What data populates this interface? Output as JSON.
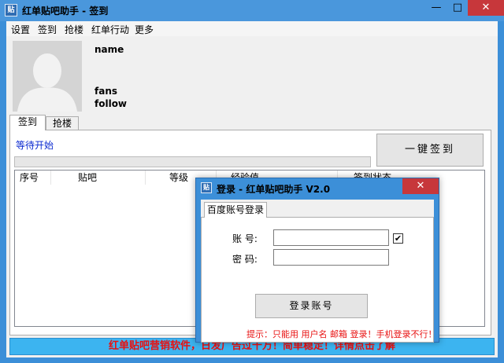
{
  "window": {
    "title": "红单贴吧助手 - 签到",
    "icon_glyph": "贴",
    "minimize_icon": "minimize-icon",
    "maximize_icon": "maximize-icon",
    "close_icon": "close-icon",
    "title_color": "#4a97dc"
  },
  "menu": [
    "设置",
    "签到",
    "抢楼",
    "红单行动",
    "更多"
  ],
  "profile": {
    "name_label": "name",
    "fans_label": "fans",
    "follow_label": "follow"
  },
  "tabs": [
    "签到",
    "抢楼"
  ],
  "sign_panel": {
    "status": "等待开始",
    "progress": 0,
    "sign_button": "一键签到",
    "columns": [
      "序号",
      "贴吧",
      "等级",
      "经验值",
      "签到状态"
    ]
  },
  "footer_text": "红单贴吧营销软件，日发广告过千万！简单稳定！详情点击了解",
  "dialog": {
    "title": "登录 - 红单贴吧助手 V2.0",
    "tab": "百度账号登录",
    "account_label": "账 号:",
    "password_label": "密 码:",
    "account_value": "",
    "password_value": "",
    "remember_checked": true,
    "login_button": "登录账号",
    "hint": "提示：只能用 用户名 邮箱 登录！手机登录不行！"
  }
}
